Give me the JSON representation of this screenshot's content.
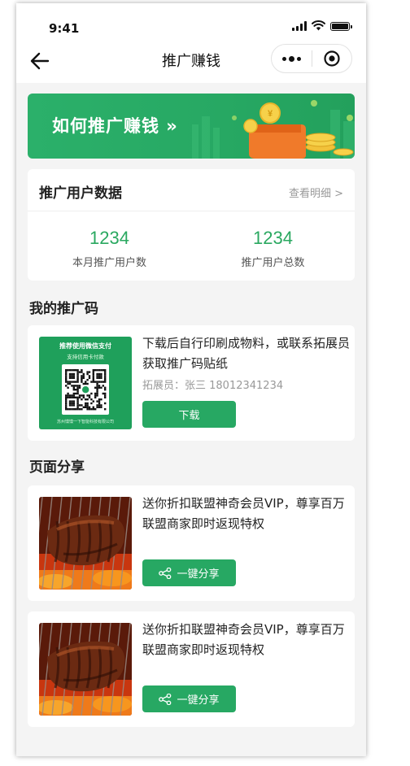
{
  "status_bar": {
    "time": "9:41"
  },
  "nav": {
    "title": "推广赚钱"
  },
  "banner": {
    "text": "如何推广赚钱 »"
  },
  "user_data": {
    "title": "推广用户数据",
    "detail_link": "查看明细 >",
    "stats": [
      {
        "value": "1234",
        "label": "本月推广用户数"
      },
      {
        "value": "1234",
        "label": "推广用户总数"
      }
    ]
  },
  "promo_code": {
    "section_title": "我的推广码",
    "qr_card": {
      "heading": "推荐使用微信支付",
      "subheading": "支持信用卡付款",
      "footer": "苏州馍馍一下智能科技有限公司"
    },
    "description": "下载后自行印刷成物料，或联系拓展员获取推广码贴纸",
    "contact": "拓展员：张三 18012341234",
    "download_label": "下载"
  },
  "page_share": {
    "section_title": "页面分享",
    "items": [
      {
        "description": "送你折扣联盟神奇会员VIP，尊享百万联盟商家即时返现特权",
        "button_label": "一键分享"
      },
      {
        "description": "送你折扣联盟神奇会员VIP，尊享百万联盟商家即时返现特权",
        "button_label": "一键分享"
      }
    ]
  },
  "colors": {
    "brand_green": "#27a863",
    "stat_green": "#2aa860",
    "page_bg": "#f4f4f4"
  },
  "icons": [
    "signal-icon",
    "wifi-icon",
    "battery-icon",
    "back-arrow-icon",
    "more-dots-icon",
    "target-icon",
    "share-icon"
  ]
}
